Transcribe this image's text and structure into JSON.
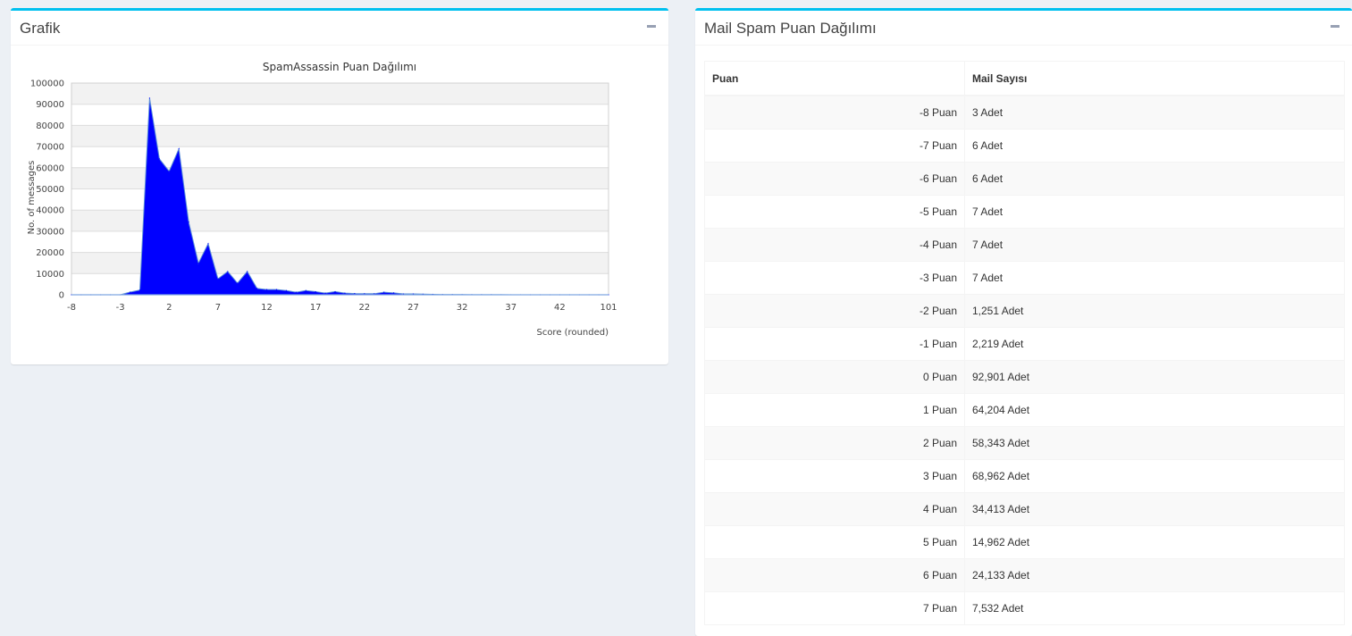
{
  "left_panel": {
    "title": "Grafik"
  },
  "right_panel": {
    "title": "Mail Spam Puan Dağılımı",
    "columns": [
      "Puan",
      "Mail Sayısı"
    ],
    "rows": [
      {
        "score": "-8 Puan",
        "count": "3 Adet"
      },
      {
        "score": "-7 Puan",
        "count": "6 Adet"
      },
      {
        "score": "-6 Puan",
        "count": "6 Adet"
      },
      {
        "score": "-5 Puan",
        "count": "7 Adet"
      },
      {
        "score": "-4 Puan",
        "count": "7 Adet"
      },
      {
        "score": "-3 Puan",
        "count": "7 Adet"
      },
      {
        "score": "-2 Puan",
        "count": "1,251 Adet"
      },
      {
        "score": "-1 Puan",
        "count": "2,219 Adet"
      },
      {
        "score": "0 Puan",
        "count": "92,901 Adet"
      },
      {
        "score": "1 Puan",
        "count": "64,204 Adet"
      },
      {
        "score": "2 Puan",
        "count": "58,343 Adet"
      },
      {
        "score": "3 Puan",
        "count": "68,962 Adet"
      },
      {
        "score": "4 Puan",
        "count": "34,413 Adet"
      },
      {
        "score": "5 Puan",
        "count": "14,962 Adet"
      },
      {
        "score": "6 Puan",
        "count": "24,133 Adet"
      },
      {
        "score": "7 Puan",
        "count": "7,532 Adet"
      }
    ]
  },
  "chart_data": {
    "type": "area",
    "title": "SpamAssassin Puan Dağılımı",
    "xlabel": "Score (rounded)",
    "ylabel": "No. of messages",
    "ylim": [
      0,
      100000
    ],
    "yticks": [
      0,
      10000,
      20000,
      30000,
      40000,
      50000,
      60000,
      70000,
      80000,
      90000,
      100000
    ],
    "xtick_labels": [
      "-8",
      "-3",
      "2",
      "7",
      "12",
      "17",
      "22",
      "27",
      "32",
      "37",
      "42",
      "101"
    ],
    "grid": true,
    "color": "#0000ff",
    "x": [
      "-8",
      "-7",
      "-6",
      "-5",
      "-4",
      "-3",
      "-2",
      "-1",
      "0",
      "1",
      "2",
      "3",
      "4",
      "5",
      "6",
      "7",
      "8",
      "9",
      "10",
      "11",
      "12",
      "13",
      "14",
      "15",
      "16",
      "17",
      "18",
      "19",
      "20",
      "21",
      "22",
      "23",
      "24",
      "25",
      "26",
      "27",
      "28",
      "29",
      "30",
      "31",
      "32",
      "33",
      "34",
      "35",
      "36",
      "37",
      "38",
      "39",
      "40",
      "41",
      "42",
      "43",
      "44",
      "45",
      "46",
      "101"
    ],
    "values": [
      3,
      6,
      6,
      7,
      7,
      7,
      1251,
      2219,
      92901,
      64204,
      58343,
      68962,
      34413,
      14962,
      24133,
      7532,
      11000,
      5500,
      11000,
      3000,
      2500,
      2500,
      2000,
      1200,
      2000,
      1500,
      800,
      1500,
      800,
      600,
      500,
      500,
      1200,
      900,
      400,
      400,
      300,
      200,
      100,
      100,
      80,
      60,
      50,
      40,
      30,
      20,
      20,
      10,
      10,
      10,
      5,
      5,
      5,
      5,
      5,
      3
    ]
  }
}
